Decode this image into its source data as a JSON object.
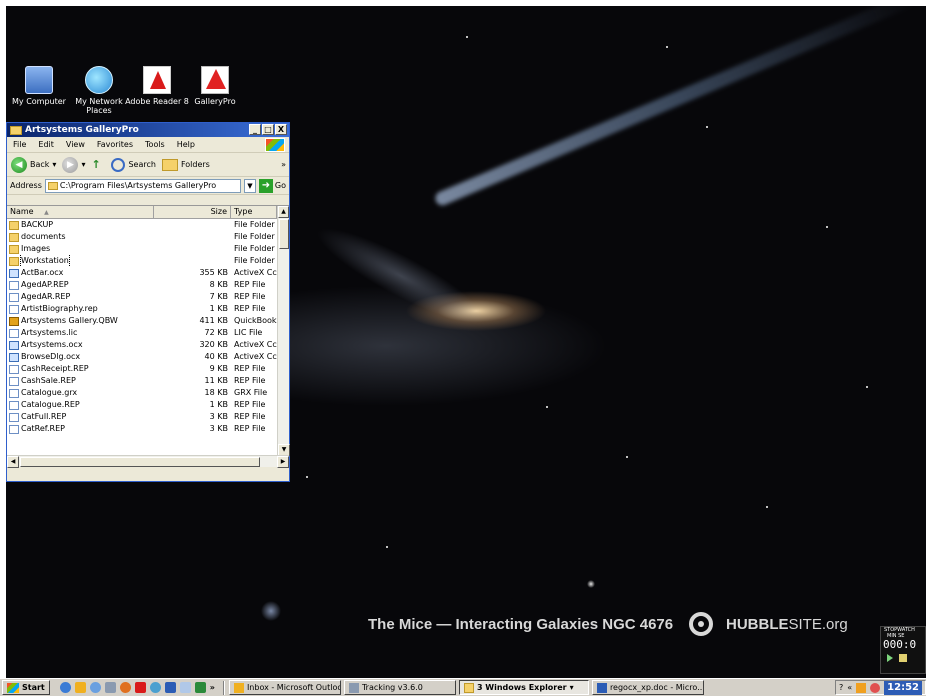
{
  "desktop": {
    "icons": [
      {
        "label": "My Computer",
        "icon": "computer-icon"
      },
      {
        "label": "My Network Places",
        "icon": "network-icon"
      },
      {
        "label": "Adobe Reader 8",
        "icon": "acrobat-icon"
      },
      {
        "label": "GalleryPro",
        "icon": "gallerypro-icon"
      }
    ],
    "wallpaper_caption": "The Mice — Interacting Galaxies NGC 4676",
    "hubble_brand_bold": "HUBBLE",
    "hubble_brand_rest": "SITE.org"
  },
  "window": {
    "title": "Artsystems GalleryPro",
    "controls": {
      "minimize": "_",
      "maximize": "□",
      "close": "X"
    },
    "menu": [
      "File",
      "Edit",
      "View",
      "Favorites",
      "Tools",
      "Help"
    ],
    "toolbar": {
      "back": "Back",
      "search": "Search",
      "folders": "Folders",
      "more": "»"
    },
    "address": {
      "label": "Address",
      "value": "C:\\Program Files\\Artsystems GalleryPro",
      "go": "Go"
    },
    "columns": {
      "name": "Name",
      "sort_indicator": "▲",
      "size": "Size",
      "type": "Type"
    },
    "files": [
      {
        "name": "BACKUP",
        "size": "",
        "type": "File Folder",
        "kind": "folder"
      },
      {
        "name": "documents",
        "size": "",
        "type": "File Folder",
        "kind": "folder"
      },
      {
        "name": "Images",
        "size": "",
        "type": "File Folder",
        "kind": "folder"
      },
      {
        "name": "Workstation",
        "size": "",
        "type": "File Folder",
        "kind": "folder"
      },
      {
        "name": "ActBar.ocx",
        "size": "355 KB",
        "type": "ActiveX Cc",
        "kind": "ocx"
      },
      {
        "name": "AgedAP.REP",
        "size": "8 KB",
        "type": "REP File",
        "kind": "file"
      },
      {
        "name": "AgedAR.REP",
        "size": "7 KB",
        "type": "REP File",
        "kind": "file"
      },
      {
        "name": "ArtistBiography.rep",
        "size": "1 KB",
        "type": "REP File",
        "kind": "file"
      },
      {
        "name": "Artsystems Gallery.QBW",
        "size": "411 KB",
        "type": "QuickBooks",
        "kind": "qbw"
      },
      {
        "name": "Artsystems.lic",
        "size": "72 KB",
        "type": "LIC File",
        "kind": "file"
      },
      {
        "name": "Artsystems.ocx",
        "size": "320 KB",
        "type": "ActiveX Cc",
        "kind": "ocx"
      },
      {
        "name": "BrowseDlg.ocx",
        "size": "40 KB",
        "type": "ActiveX Cc",
        "kind": "ocx"
      },
      {
        "name": "CashReceipt.REP",
        "size": "9 KB",
        "type": "REP File",
        "kind": "file"
      },
      {
        "name": "CashSale.REP",
        "size": "11 KB",
        "type": "REP File",
        "kind": "file"
      },
      {
        "name": "Catalogue.grx",
        "size": "18 KB",
        "type": "GRX File",
        "kind": "file"
      },
      {
        "name": "Catalogue.REP",
        "size": "1 KB",
        "type": "REP File",
        "kind": "file"
      },
      {
        "name": "CatFull.REP",
        "size": "3 KB",
        "type": "REP File",
        "kind": "file"
      },
      {
        "name": "CatRef.REP",
        "size": "3 KB",
        "type": "REP File",
        "kind": "file"
      }
    ]
  },
  "stopwatch": {
    "title": "STOPWATCH",
    "units": "MIN   SE",
    "time": "000:0"
  },
  "taskbar": {
    "start": "Start",
    "more": "»",
    "tasks": [
      {
        "label": "Inbox - Microsoft Outlook",
        "active": false
      },
      {
        "label": "Tracking v3.6.0",
        "active": false
      },
      {
        "label": "3 Windows Explorer",
        "active": true
      },
      {
        "label": "regocx_xp.doc - Micro...",
        "active": false
      }
    ],
    "tray_chevron": "«",
    "clock": "12:52"
  }
}
